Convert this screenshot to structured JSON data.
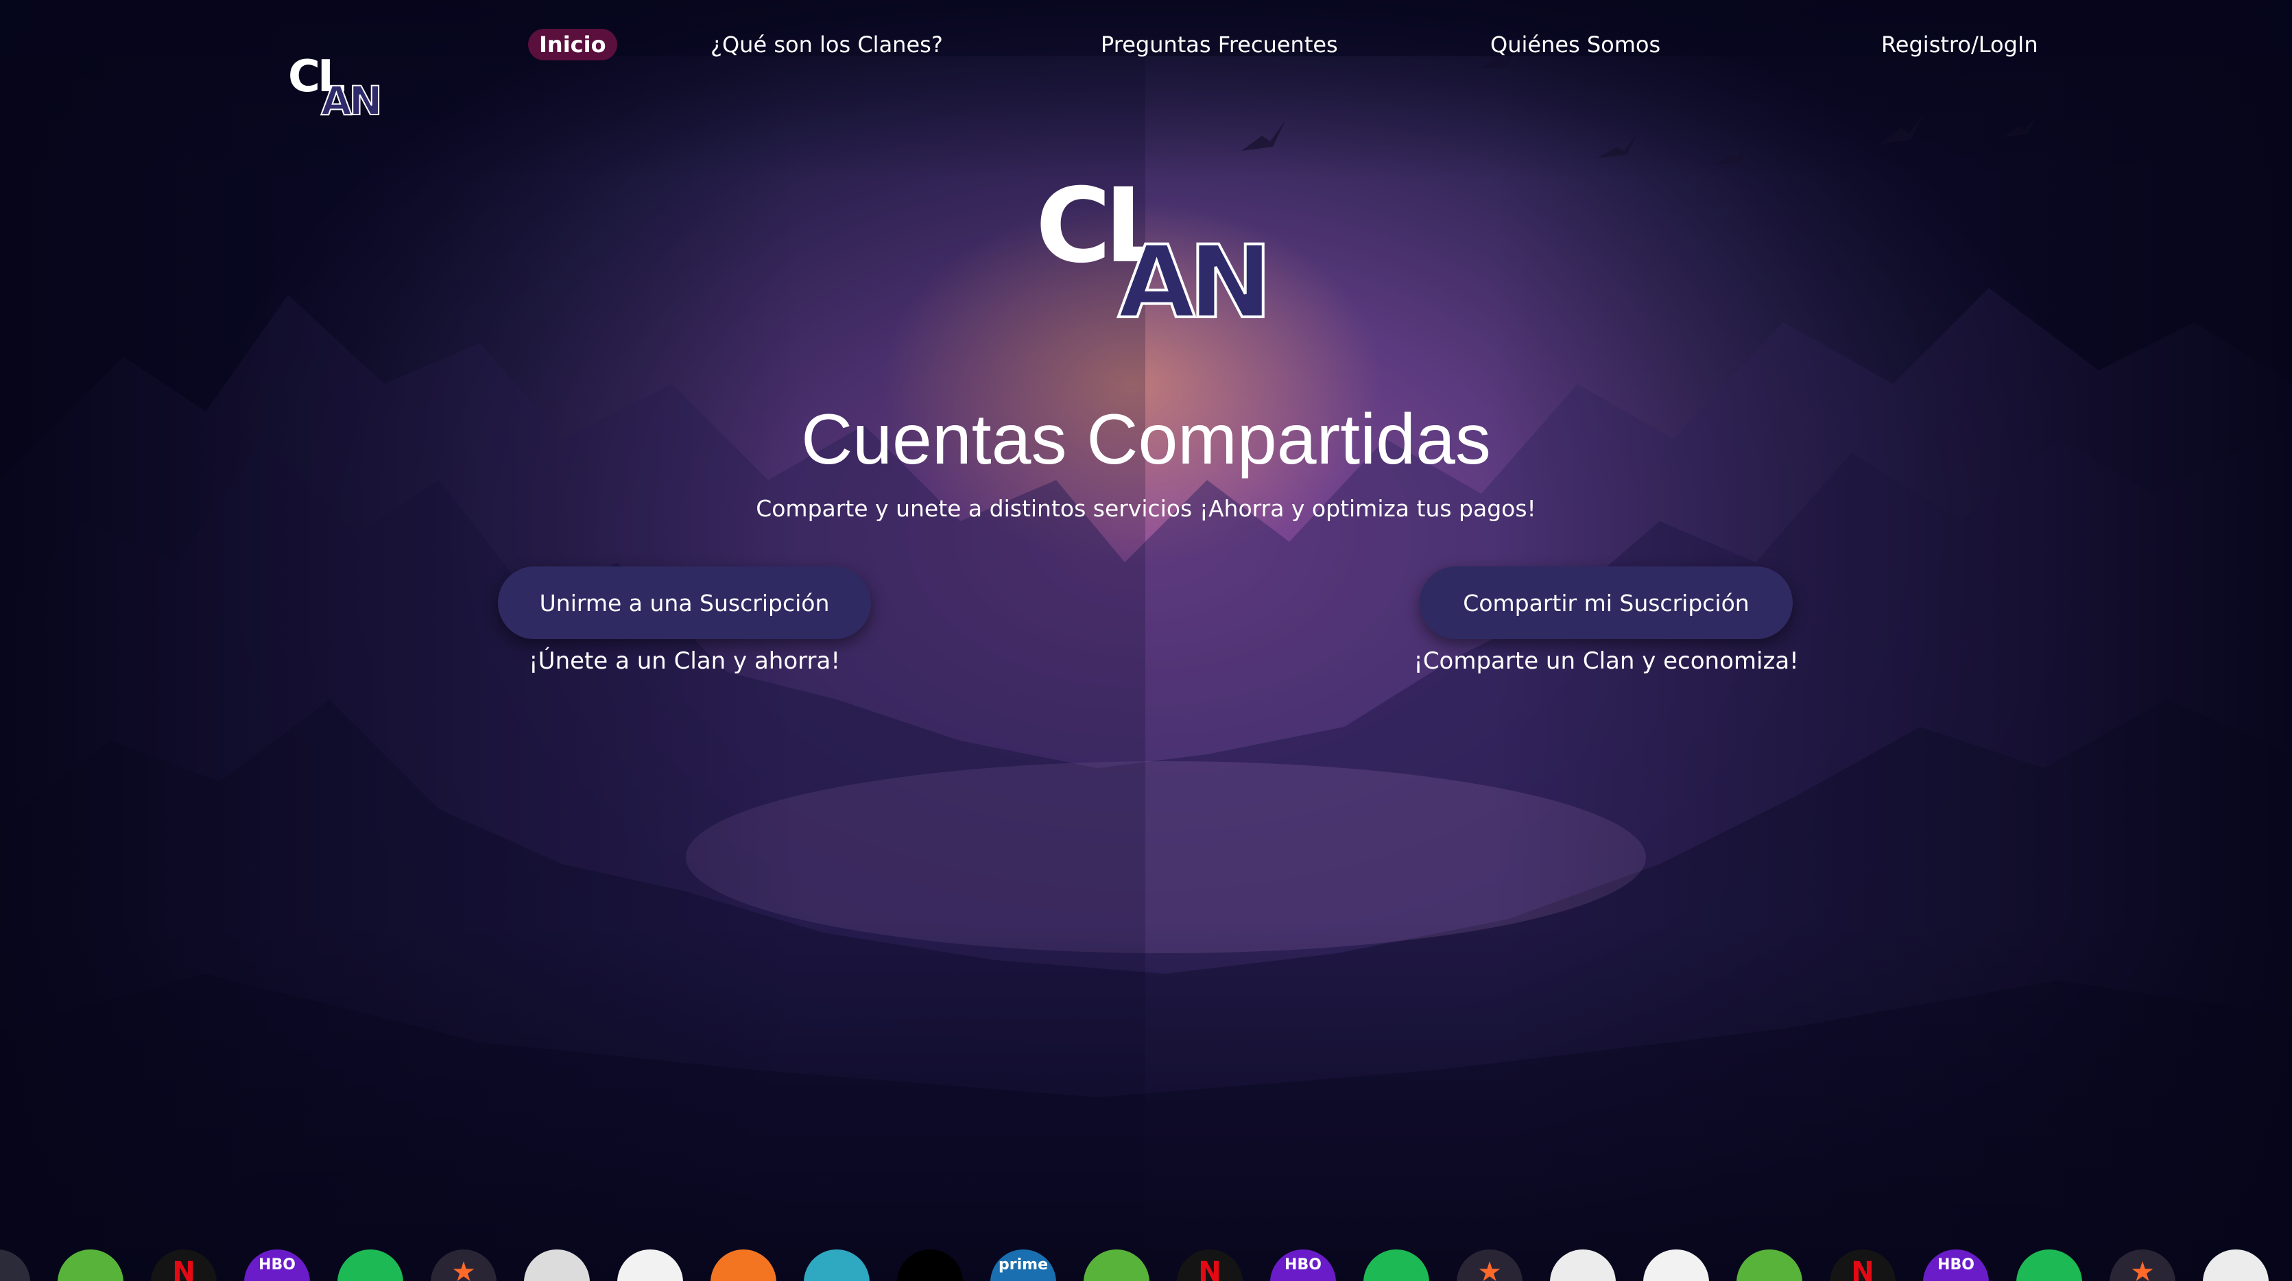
{
  "nav": {
    "items": [
      {
        "label": "Inicio",
        "active": true
      },
      {
        "label": "¿Qué son los Clanes?"
      },
      {
        "label": "Preguntas Frecuentes"
      },
      {
        "label": "Quiénes Somos"
      },
      {
        "label": "Registro/LogIn"
      }
    ]
  },
  "logo": {
    "part1": "CL",
    "part2": "AN"
  },
  "hero": {
    "title": "Cuentas Compartidas",
    "subtitle": "Comparte y unete a distintos servicios ¡Ahorra y optimiza tus pagos!"
  },
  "actions": {
    "join": {
      "label": "Unirme a una Suscripción",
      "caption": "¡Únete a un Clan y ahorra!"
    },
    "share": {
      "label": "Compartir mi Suscripción",
      "caption": "¡Comparte un Clan y economiza!"
    }
  },
  "services": {
    "prime_label": "prime",
    "netflix_label": "N",
    "hbo_label": "HBO"
  },
  "colors": {
    "button_bg": "#2f2a62",
    "active_nav_bg": "#5a0f3d",
    "logo_an": "#2f2a6a"
  }
}
